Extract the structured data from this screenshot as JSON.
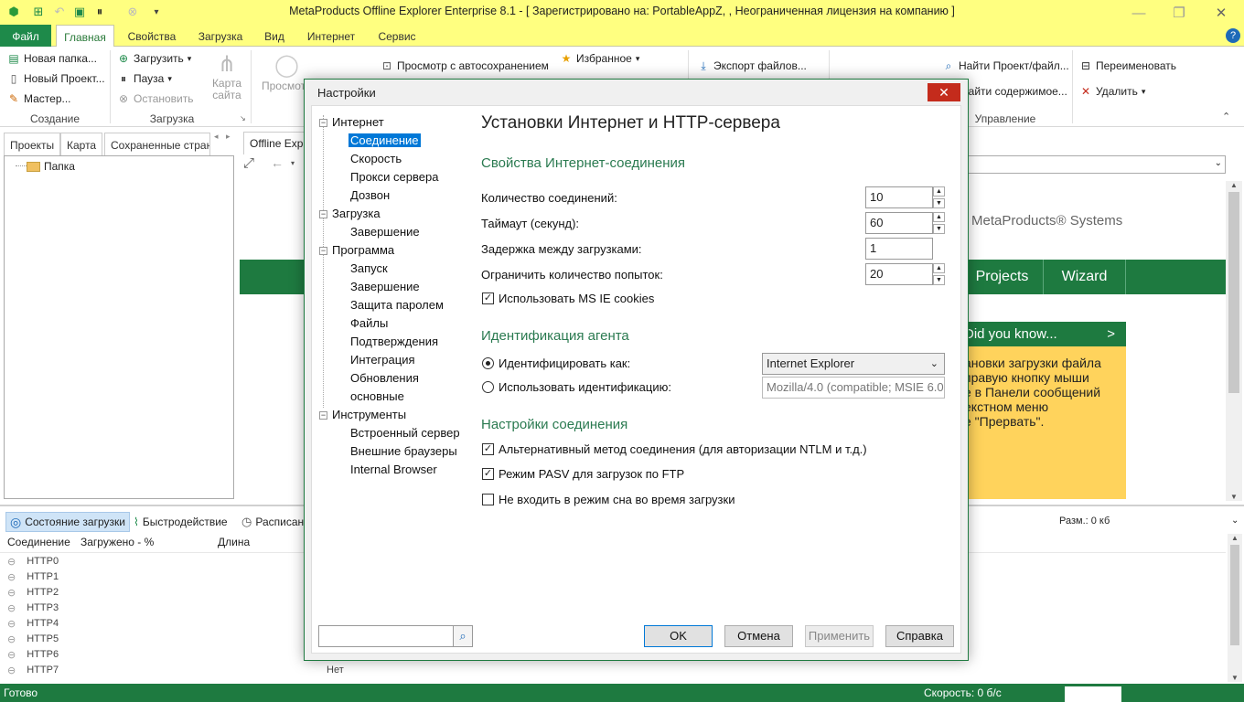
{
  "window": {
    "title": "MetaProducts Offline Explorer Enterprise 8.1 - [ Зарегистрировано на: PortableAppZ, , Неограниченная лицензия на компанию ]"
  },
  "ribbon_tabs": [
    "Файл",
    "Главная",
    "Свойства",
    "Загрузка",
    "Вид",
    "Интернет",
    "Сервис"
  ],
  "ribbon": {
    "create_group": {
      "label": "Создание",
      "new_folder": "Новая папка...",
      "new_project": "Новый Проект...",
      "wizard": "Мастер..."
    },
    "download_group": {
      "label": "Загрузка",
      "download": "Загрузить",
      "pause": "Пауза",
      "stop": "Остановить",
      "site_map": "Карта сайта"
    },
    "view": {
      "view_label": "Просмотр",
      "autosave_view": "Просмотр с автосохранением"
    },
    "favorites": "Избранное",
    "export": "Экспорт файлов...",
    "manage_group": {
      "label": "Управление",
      "find_project": "Найти Проект/файл...",
      "find_content": "Найти содержимое...",
      "rename": "Переименовать",
      "delete": "Удалить"
    }
  },
  "left_panel": {
    "tabs": [
      "Проекты",
      "Карта",
      "Сохраненные страни"
    ],
    "tree_root": "Папка"
  },
  "content": {
    "tab_label": "Offline Explor",
    "brand": "MetaProducts® Systems",
    "nav_buttons": [
      "Projects",
      "Wizard"
    ],
    "did_you_know": {
      "title": "Did you know...",
      "arrow": ">",
      "text": [
        "ановки загрузки файла",
        " правую кнопку мыши",
        "е в Панели сообщений",
        "екстном меню",
        "е \"Прервать\"."
      ]
    }
  },
  "bottom_panel": {
    "tabs": [
      "Состояние загрузки",
      "Быстродействие",
      "Расписан"
    ],
    "size_label": "Разм.: 0 кб",
    "columns": [
      "Соединение",
      "Загружено - %",
      "Длина"
    ],
    "rows": [
      "HTTP0",
      "HTTP1",
      "HTTP2",
      "HTTP3",
      "HTTP4",
      "HTTP5",
      "HTTP6",
      "HTTP7"
    ],
    "partial_value": "Нет"
  },
  "status": {
    "ready": "Готово",
    "speed": "Скорость: 0 б/с"
  },
  "dialog": {
    "title": "Настройки",
    "close": "✕",
    "tree": [
      {
        "label": "Интернет",
        "children": [
          "Соединение",
          "Скорость",
          "Прокси сервера",
          "Дозвон"
        ]
      },
      {
        "label": "Загрузка",
        "children": [
          "Завершение"
        ]
      },
      {
        "label": "Программа",
        "children": [
          "Запуск",
          "Завершение",
          "Защита паролем",
          "Файлы",
          "Подтверждения",
          "Интеграция",
          "Обновления",
          "основные"
        ]
      },
      {
        "label": "Инструменты",
        "children": [
          "Встроенный сервер",
          "Внешние браузеры",
          "Internal Browser"
        ]
      }
    ],
    "heading": "Установки Интернет и HTTP-сервера",
    "section_connection": "Свойства Интернет-соединения",
    "connections_label": "Количество соединений:",
    "connections_value": "10",
    "timeout_label": "Таймаут (секунд):",
    "timeout_value": "60",
    "delay_label": "Задержка между загрузками:",
    "delay_value": "1",
    "retries_label": "Ограничить количество попыток:",
    "retries_value": "20",
    "ie_cookies": "Использовать MS IE cookies",
    "section_agent": "Идентификация агента",
    "identify_as": "Идентифицировать как:",
    "identify_value": "Internet Explorer",
    "use_ident": "Использовать идентификацию:",
    "use_ident_value": "Mozilla/4.0 (compatible; MSIE 6.0",
    "section_settings": "Настройки соединения",
    "alt_method": "Альтернативный метод соединения (для авторизации NTLM и т.д.)",
    "pasv_mode": "Режим PASV для загрузок по FTP",
    "no_sleep": "Не входить в режим сна во время загрузки",
    "search_placeholder": "",
    "buttons": {
      "ok": "OK",
      "cancel": "Отмена",
      "apply": "Применить",
      "help": "Справка"
    }
  }
}
